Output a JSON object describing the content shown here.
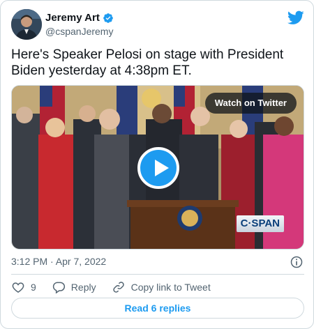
{
  "author": {
    "name": "Jeremy Art",
    "handle": "@cspanJeremy",
    "verified": true,
    "avatar_icon": "profile-photo"
  },
  "tweet": {
    "text": "Here's Speaker Pelosi on stage with President Biden yesterday at 4:38pm ET.",
    "timestamp": "3:12 PM · Apr 7, 2022"
  },
  "media": {
    "watch_label": "Watch on Twitter",
    "watermark": "C·SPAN",
    "play_icon": "play-icon"
  },
  "actions": {
    "like_count": "9",
    "reply_label": "Reply",
    "copy_link_label": "Copy link to Tweet"
  },
  "footer": {
    "read_replies_label": "Read 6 replies"
  },
  "colors": {
    "accent": "#1d9bf0",
    "text_primary": "#0f1419",
    "text_secondary": "#536471",
    "border": "#cfd9de"
  }
}
